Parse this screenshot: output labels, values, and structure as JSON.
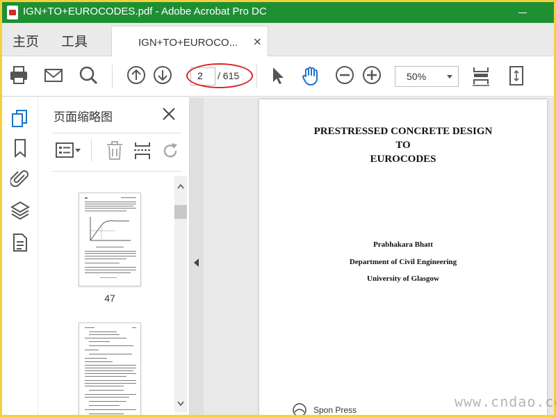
{
  "window": {
    "title": "IGN+TO+EUROCODES.pdf - Adobe Acrobat Pro DC"
  },
  "nav": {
    "home": "主页",
    "tools": "工具"
  },
  "tab": {
    "label": "IGN+TO+EUROCO...",
    "close": "×"
  },
  "toolbar": {
    "print": "print-icon",
    "email": "envelope-icon",
    "search": "search-icon",
    "prev_page": "arrow-up-circle-icon",
    "next_page": "arrow-down-circle-icon",
    "current_page": "2",
    "page_total": "/ 615",
    "select_tool": "cursor-icon",
    "hand_tool": "hand-icon",
    "zoom_out": "minus-circle-icon",
    "zoom_in": "plus-circle-icon",
    "zoom_value": "50%",
    "fit_width": "fit-width-icon",
    "fit_page": "fit-page-icon"
  },
  "leftnav": {
    "items": [
      "thumbnails-icon",
      "bookmark-icon",
      "attachment-icon",
      "layers-icon",
      "document-icon"
    ],
    "accent": "#1a73c9"
  },
  "thumbnails_panel": {
    "title": "页面缩略图",
    "pages": [
      {
        "label": "47"
      }
    ]
  },
  "document": {
    "title_lines": [
      "PRESTRESSED CONCRETE DESIGN",
      "TO",
      "EUROCODES"
    ],
    "author": "Prabhakara Bhatt",
    "department": "Department of Civil Engineering",
    "university": "University of Glasgow",
    "publisher": "Spon Press"
  },
  "overlay": {
    "watermark": "www.cndao.com"
  },
  "colors": {
    "titlebar": "#1f8f34",
    "highlight": "#d92323",
    "border": "#f2d13a"
  }
}
